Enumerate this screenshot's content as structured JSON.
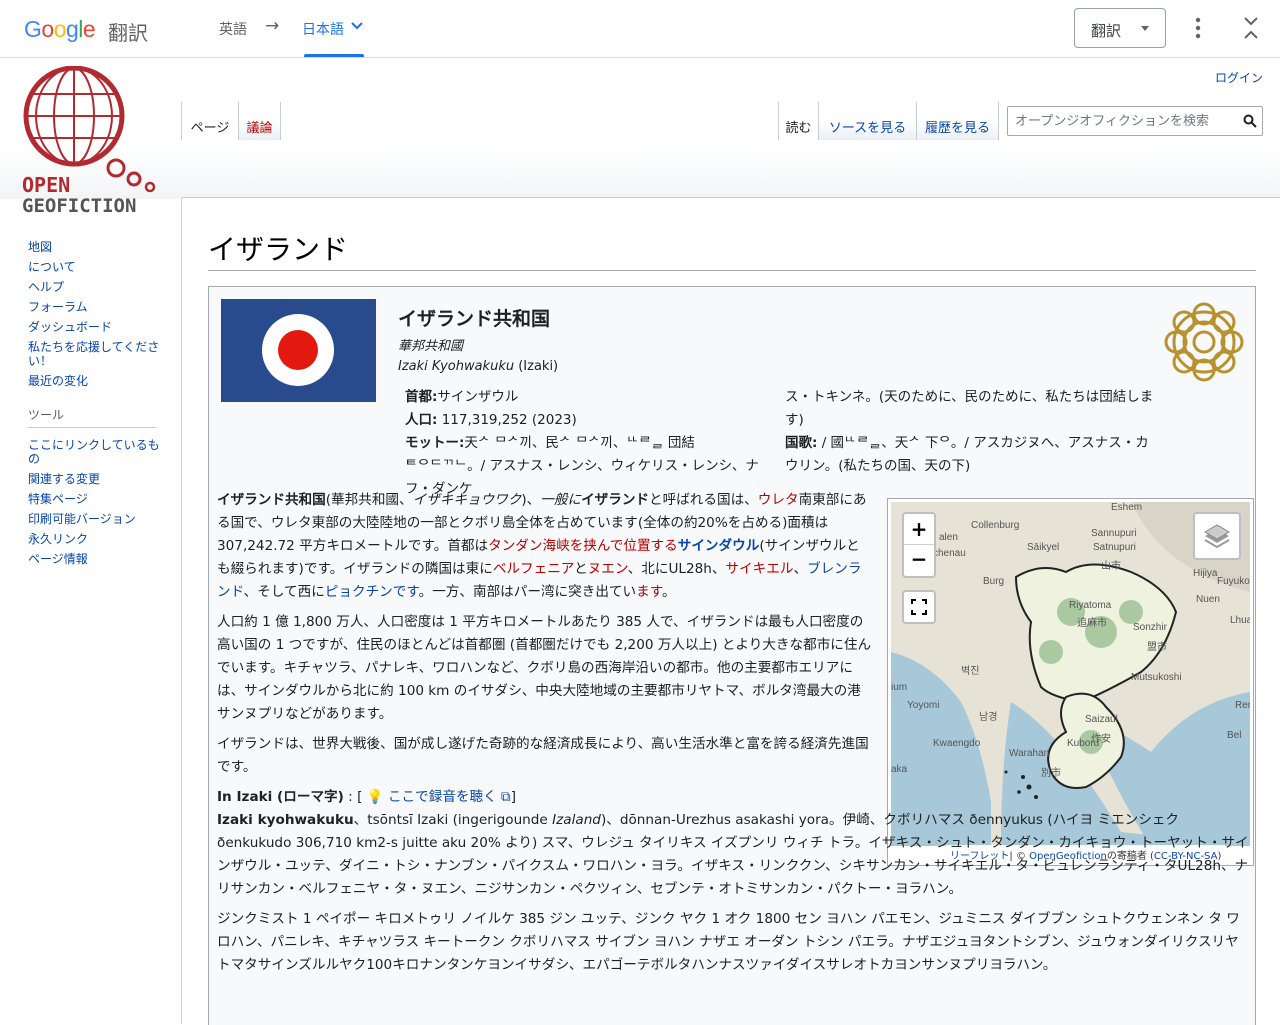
{
  "gt": {
    "logo": "Google",
    "title": "翻訳",
    "source_lang": "英語",
    "arrow": "→",
    "target_lang": "日本語",
    "button_label": "翻訳"
  },
  "wiki": {
    "login": "ログイン",
    "tabs_left": [
      "ページ",
      "議論"
    ],
    "tabs_right": [
      "読む",
      "ソースを見る",
      "履歴を見る"
    ],
    "search_placeholder": "オープンジオフィクションを検索",
    "logo_text": [
      "OPEN",
      "GEOFICTION"
    ]
  },
  "sidebar": {
    "main": [
      "地図",
      "について",
      "ヘルプ",
      "フォーラム",
      "ダッシュボード",
      "私たちを応援してください！",
      "最近の変化"
    ],
    "tools_heading": "ツール",
    "tools": [
      "ここにリンクしているもの",
      "関連する変更",
      "特集ページ",
      "印刷可能バージョン",
      "永久リンク",
      "ページ情報"
    ]
  },
  "page": {
    "title": "イザランド"
  },
  "infobox": {
    "name": "イザランド共和国",
    "alt_name_1": "華邦共和國",
    "alt_name_2_italic": "Izaki Kyohwakuku",
    "alt_name_2_rest": " (Izaki)",
    "capital_key": "首都:",
    "capital_val": "サインザウル",
    "population_key": "人口:",
    "population_val": " 117,319,252 (2023)",
    "motto_key": "モットー:",
    "motto_val": "天ᄼ ᄆᄼ끼、民ᄼ ᄆᄼ끼、ᄔᄅᆯ 団結ᄐᄋᄃᄁᄂ。/ アスナス・レンシ、ウィケリス・レンシ、ナフ・ダンケ",
    "motto_cont": "ス・トキンネ。(天のために、民のために、私たちは団結します)",
    "anthem_key": "国歌:",
    "anthem_val": " / 國ᄔᄅᆯ、天ᄼ 下ᄋ。/ アスカジヌへ、アスナス・カウリン。(私たちの国、天の下)"
  },
  "body": {
    "p1": [
      {
        "t": "イザランド共和国",
        "c": "bold"
      },
      {
        "t": "(華邦共和國、"
      },
      {
        "t": "イザキキョウワク",
        "c": "italic"
      },
      {
        "t": ")、"
      },
      {
        "t": "一般に",
        "c": "italic"
      },
      {
        "t": "イザランド",
        "c": "bold"
      },
      {
        "t": "と呼ばれる国は、"
      },
      {
        "t": "ウレタ",
        "c": "red"
      },
      {
        "t": "南東部にある国で、ウレタ東部の大陸陸地の一部とクボリ島全体を占めています(全体の約20%を占める)面積は 307,242.72 平方キロメートルです。首都は"
      },
      {
        "t": "タンダン海峡を挟んで位置する",
        "c": "red"
      },
      {
        "t": "サインダウル",
        "c": "bluebold"
      },
      {
        "t": "(サインザウルとも綴られます)です。イザランドの隣国は東に"
      },
      {
        "t": "ベルフェニア",
        "c": "red"
      },
      {
        "t": "と"
      },
      {
        "t": "ヌエン",
        "c": "red"
      },
      {
        "t": "、北にUL28h、"
      },
      {
        "t": "サイキエル",
        "c": "red"
      },
      {
        "t": "、"
      },
      {
        "t": "ブレンランド",
        "c": "blue"
      },
      {
        "t": "、そして西に"
      },
      {
        "t": "ピョクチンです",
        "c": "blue"
      },
      {
        "t": "。一方、南部はパー湾に突き出てい"
      },
      {
        "t": "ます",
        "c": "red"
      },
      {
        "t": "。"
      }
    ],
    "p2": "人口約 1 億 1,800 万人、人口密度は 1 平方キロメートルあたり 385 人で、イザランドは最も人口密度の高い国の 1 つですが、住民のほとんどは首都圏 (首都圏だけでも 2,200 万人以上) とより大きな都市に住んでいます。キチャツラ、パナレキ、ワロハンなど、クボリ島の西海岸沿いの都市。他の主要都市エリアには、サインダウルから北に約 100 km のイサダシ、中央大陸地域の主要都市リヤトマ、ボルタ湾最大の港サンヌプリなどがあります。",
    "p3": "イザランドは、世界大戦後、国が成し遂げた奇跡的な経済成長により、高い生活水準と富を誇る経済先進国です。",
    "p4_label": "In Izaki (ローマ字)",
    "p4_sep": " : [ ",
    "p4_link": "ここで録音を聴く",
    "p4_end": "]",
    "p5_bold": "Izaki kyohwakuku",
    "p5_a": "、tsōntsī Izaki (ingerigounde ",
    "p5_italic": "Izaland",
    "p5_b": ")、dōnnan-Urezhus asakashi yora。伊崎、クボリハマス ðennyukus (ハイヨ ミエンシェク ðenkukudo 306,710 km2-s juitte aku 20% より) スマ、ウレジュ タイリキス イズプンリ ウィチ トラ。イザキス・シュト・タンダン・カイキョウ・トーヤット・サインザウル・ユッテ、ダイニ・トシ・ナンブン・パイクスム・ワロハン・ヨラ。イザキス・リンククン、シキサンカン・サイキエル・タ・ビュレンランティ・タUL28h、ナリサンカン・ベルフェニヤ・タ・ヌエン、ニジサンカン・ペクツィン、セブンテ・オトミサンカン・パクトー・ヨラハン。",
    "p6": "ジンクミスト 1 ペイポー キロメトゥリ ノイルケ 385 ジン ユッテ、ジンク ヤク 1 オク 1800 セン ヨハン パエモン、ジュミニス ダイブブン シュトクウェンネン タ ワロハン、パニレキ、キチャツラス キートークン クボリハマス サイブン ヨハン ナザエ オーダン トシン パエラ。ナザエジュヨタントシブン、ジュウォンダイリクスリヤトマタサインズルルヤク100キロナンタンケヨンイサダシ、エパゴーテボルタハンナスツァイダイスサレオトカヨンサンヌプリヨラハン。"
  },
  "map": {
    "labels": [
      "Collenburg",
      "Sannupuri",
      "Satnupuri",
      "山市",
      "Sāikyel",
      "chenau",
      "Burg",
      "Hijiya",
      "Fuyuko",
      "Nuen",
      "Lhuad",
      "Riyatoma",
      "追麻市",
      "Sonzhir",
      "盟市",
      "Mutsukoshi",
      "벽진",
      "ium",
      "Yoyomi",
      "Kwaengdo",
      "남경",
      "Saizaul",
      "作安",
      "Kuboru",
      "Warahan",
      "別市",
      "Remi",
      "Bel",
      "aka",
      "alen",
      "Eshem"
    ],
    "attribution_link": "リーフレット",
    "attribution_mid": "| © ",
    "attribution_osm": "OpenGeofiction",
    "attribution_mid2": "の寄稿者 (",
    "attribution_lic": "CC-BY-NC-SA",
    "attribution_end": ")"
  }
}
